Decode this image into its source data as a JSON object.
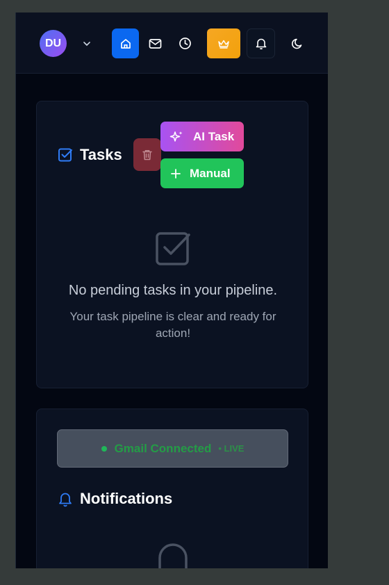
{
  "header": {
    "avatar_initials": "DU",
    "icons": [
      "chevron-down-icon",
      "home-icon",
      "mail-icon",
      "clock-icon",
      "crown-icon",
      "bell-icon",
      "moon-icon"
    ]
  },
  "tasks": {
    "title": "Tasks",
    "ai_task_label": "AI Task",
    "manual_label": "Manual",
    "empty_title": "No pending tasks in your pipeline.",
    "empty_subtitle": "Your task pipeline is clear and ready for action!"
  },
  "notifications": {
    "gmail_status": "Gmail Connected",
    "live_label": "• LIVE",
    "title": "Notifications"
  },
  "colors": {
    "accent_blue": "#0b68f0",
    "ai_gradient_start": "#a853f2",
    "ai_gradient_end": "#e14a9b",
    "manual_green": "#21c45a",
    "crown_orange": "#f6a723",
    "trash_red": "#7a2a36",
    "background": "#030712"
  }
}
